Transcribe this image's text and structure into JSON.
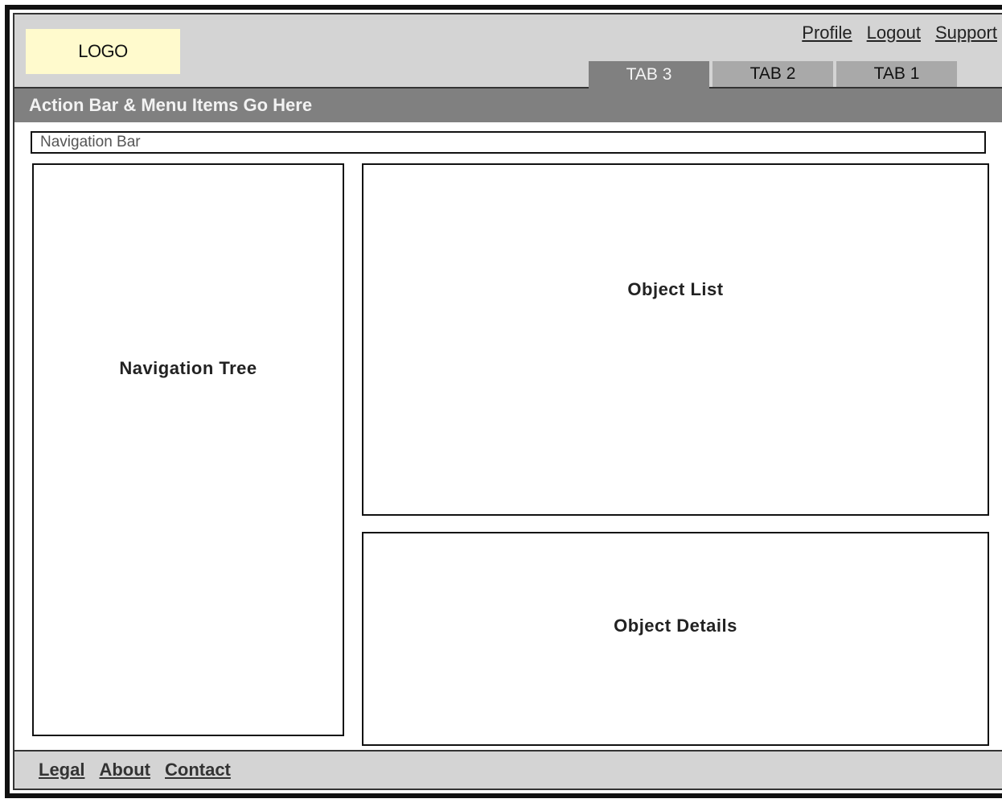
{
  "header": {
    "logo_text": "LOGO",
    "links": [
      {
        "label": "Profile"
      },
      {
        "label": "Logout"
      },
      {
        "label": "Support"
      }
    ],
    "tabs": [
      {
        "label": "TAB 3",
        "active": true
      },
      {
        "label": "TAB 2",
        "active": false
      },
      {
        "label": "TAB 1",
        "active": false
      }
    ]
  },
  "action_bar": {
    "text": "Action Bar & Menu Items Go Here"
  },
  "navigation_bar": {
    "text": "Navigation Bar"
  },
  "panels": {
    "navigation_tree": "Navigation Tree",
    "object_list": "Object List",
    "object_details": "Object Details"
  },
  "footer": {
    "links": [
      {
        "label": "Legal"
      },
      {
        "label": "About"
      },
      {
        "label": "Contact"
      }
    ]
  },
  "colors": {
    "header_bg": "#d4d4d4",
    "logo_bg": "#fffacd",
    "action_bar_bg": "#808080",
    "active_tab_bg": "#808080",
    "inactive_tab_bg": "#a9a9a9",
    "footer_bg": "#d4d4d4"
  }
}
